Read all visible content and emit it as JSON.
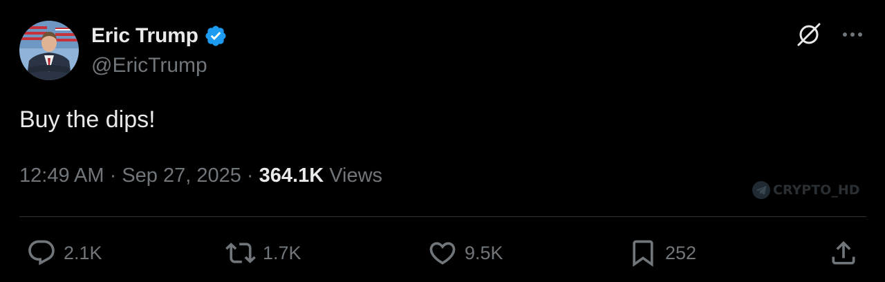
{
  "author": {
    "display_name": "Eric Trump",
    "handle": "@EricTrump",
    "verified": true,
    "avatar_icon": "profile-photo"
  },
  "tweet": {
    "text": "Buy the dips!",
    "time": "12:49 AM",
    "date": "Sep 27, 2025",
    "views_count": "364.1K",
    "views_label": "Views"
  },
  "top_actions": {
    "grok_icon": "grok-icon",
    "more_icon": "more-horizontal-icon"
  },
  "watermark": {
    "text": "CRYPTO_HD",
    "icon": "telegram-icon"
  },
  "stats": {
    "replies": "2.1K",
    "reposts": "1.7K",
    "likes": "9.5K",
    "bookmarks": "252"
  },
  "colors": {
    "background": "#000000",
    "primary_text": "#e7e9ea",
    "secondary_text": "#71767b",
    "verified_blue": "#1d9bf0",
    "divider": "#2f3336"
  }
}
